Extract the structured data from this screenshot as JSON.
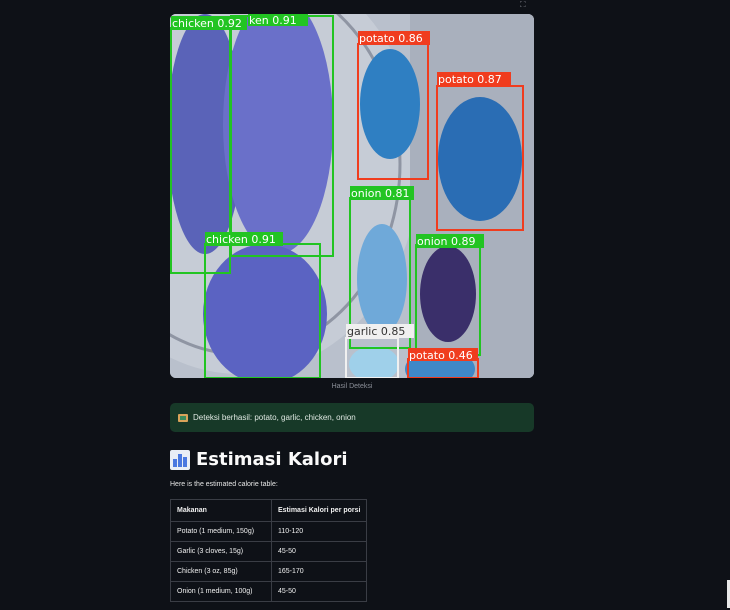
{
  "toolbar": {
    "corner_glyph": "⛶"
  },
  "detection_image": {
    "caption": "Hasil Deteksi",
    "detections": [
      {
        "label": "chicken 0.92",
        "class": "chicken",
        "color": "#22c422"
      },
      {
        "label": "ken 0.91",
        "class": "chicken",
        "color": "#22c422"
      },
      {
        "label": "potato 0.86",
        "class": "potato",
        "color": "#f03c1e"
      },
      {
        "label": "potato 0.87",
        "class": "potato",
        "color": "#f03c1e"
      },
      {
        "label": "onion 0.81",
        "class": "onion",
        "color": "#22c422"
      },
      {
        "label": "chicken 0.91",
        "class": "chicken",
        "color": "#22c422"
      },
      {
        "label": "onion 0.89",
        "class": "onion",
        "color": "#22c422"
      },
      {
        "label": "garlic 0.85",
        "class": "garlic",
        "color": "#f0f0f0"
      },
      {
        "label": "potato 0.46",
        "class": "potato",
        "color": "#f03c1e"
      }
    ]
  },
  "alert": {
    "icon": "card-icon",
    "text": "Deteksi berhasil: potato, garlic, chicken, onion",
    "background": "#173928"
  },
  "section": {
    "icon": "bar-chart-icon",
    "title": "Estimasi Kalori",
    "intro": "Here is the estimated calorie table:"
  },
  "table": {
    "headers": [
      "Makanan",
      "Estimasi Kalori per porsi"
    ],
    "rows": [
      [
        "Potato (1 medium, 150g)",
        "110-120"
      ],
      [
        "Garlic (3 cloves, 15g)",
        "45-50"
      ],
      [
        "Chicken (3 oz, 85g)",
        "165-170"
      ],
      [
        "Onion (1 medium, 100g)",
        "45-50"
      ]
    ]
  }
}
